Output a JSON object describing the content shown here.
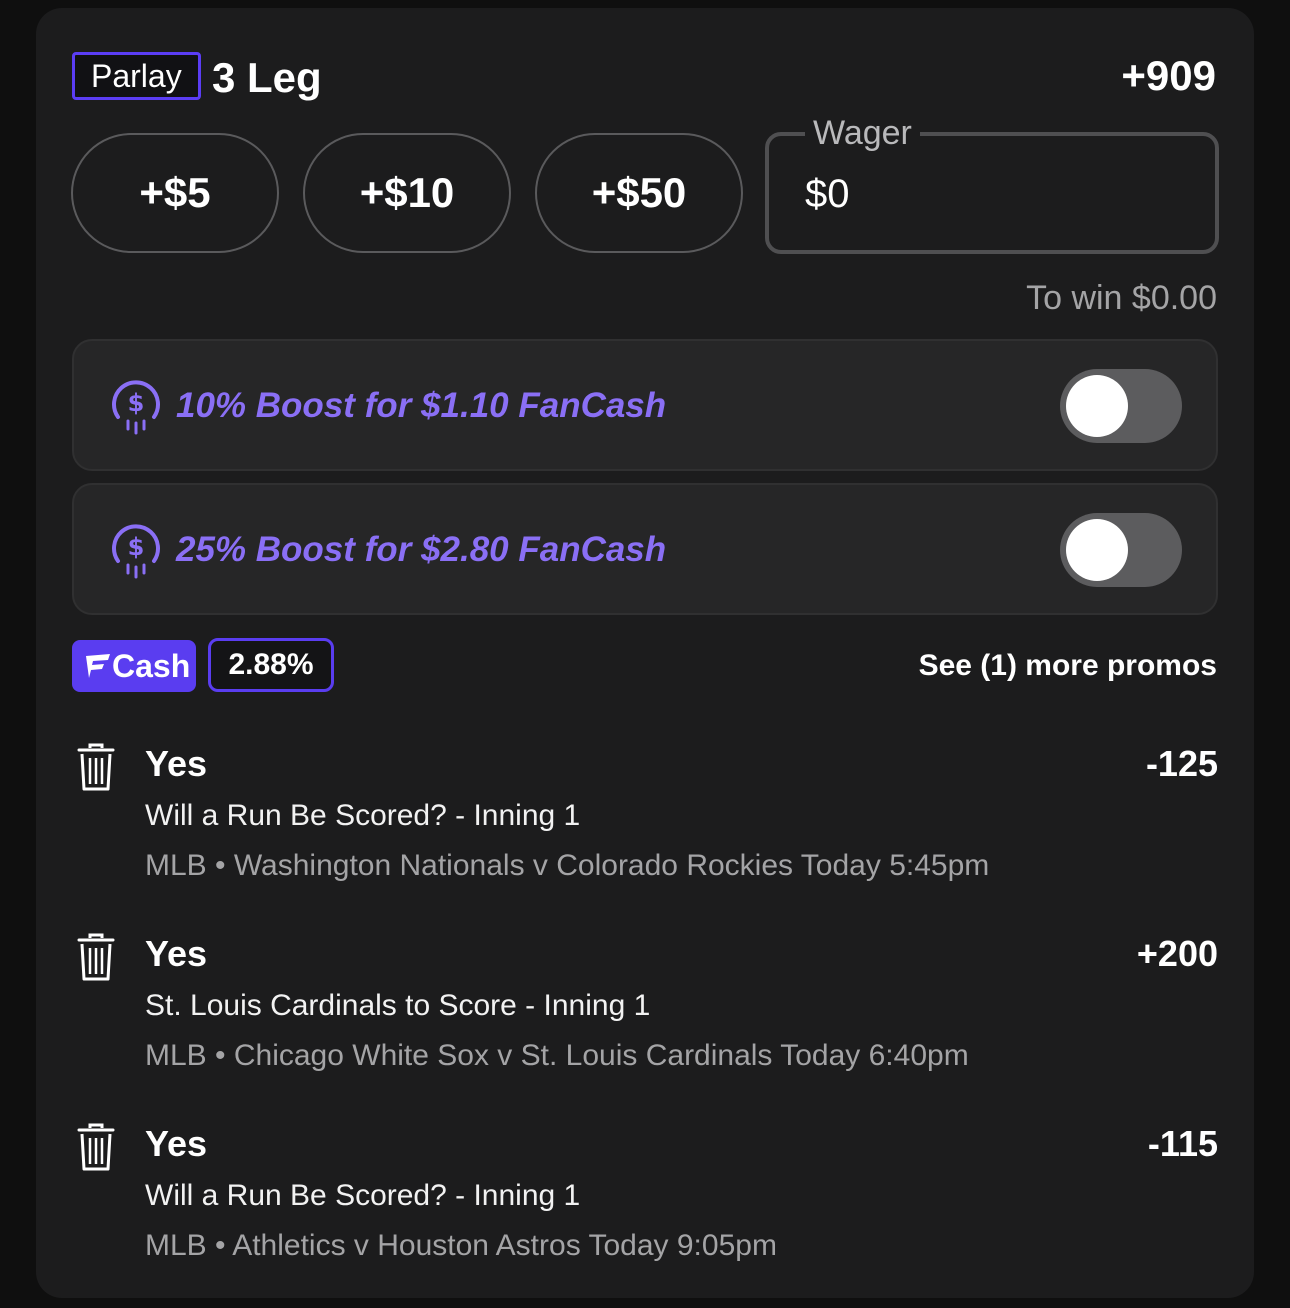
{
  "header": {
    "badge": "Parlay",
    "title": "3 Leg",
    "odds": "+909"
  },
  "quick_amounts": [
    "+$5",
    "+$10",
    "+$50"
  ],
  "wager": {
    "label": "Wager",
    "value": "$0",
    "to_win": "To win $0.00"
  },
  "boosts": [
    {
      "icon": "fancash-coin-icon",
      "label": "10% Boost for $1.10 FanCash",
      "enabled": false
    },
    {
      "icon": "fancash-coin-icon",
      "label": "25% Boost for $2.80 FanCash",
      "enabled": false
    }
  ],
  "fancash": {
    "badge": "Cash",
    "percent": "2.88%",
    "more_promos": "See (1) more promos"
  },
  "legs": [
    {
      "pick": "Yes",
      "odds": "-125",
      "market": "Will a Run Be Scored? - Inning 1",
      "meta": "MLB • Washington Nationals v Colorado Rockies Today 5:45pm"
    },
    {
      "pick": "Yes",
      "odds": "+200",
      "market": "St. Louis Cardinals to Score - Inning 1",
      "meta": "MLB • Chicago White Sox v St. Louis Cardinals Today 6:40pm"
    },
    {
      "pick": "Yes",
      "odds": "-115",
      "market": "Will a Run Be Scored? - Inning 1",
      "meta": "MLB • Athletics v Houston Astros Today 9:05pm"
    }
  ],
  "colors": {
    "accent": "#5a3df0",
    "boost_text": "#8a6ff5",
    "card_bg": "#1c1c1d",
    "page_bg": "#0f0f0f"
  }
}
